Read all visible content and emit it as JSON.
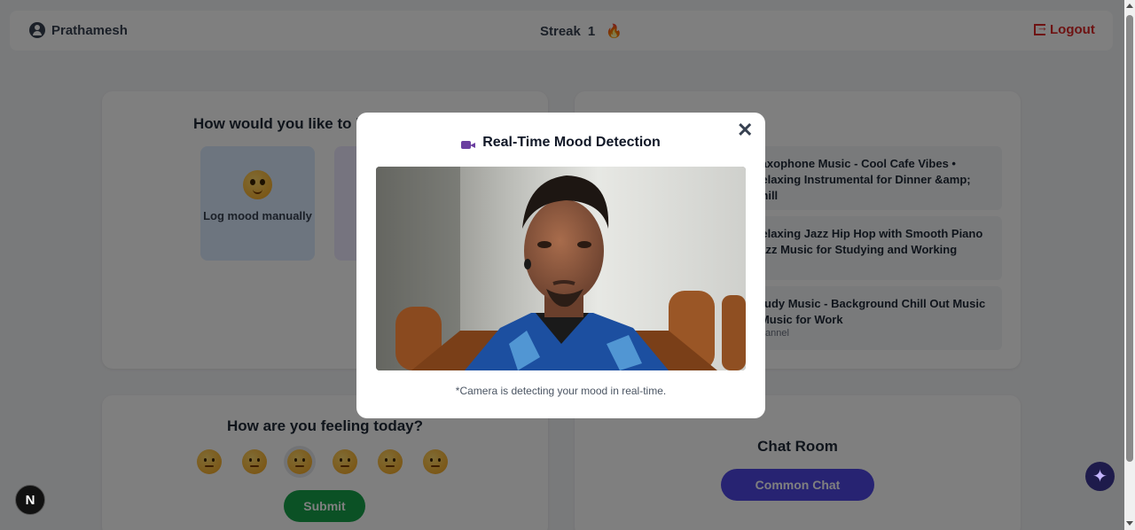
{
  "header": {
    "user_name": "Prathamesh",
    "streak_label": "Streak",
    "streak_count": "1",
    "streak_icon": "🔥",
    "logout_label": "Logout"
  },
  "log_card": {
    "title": "How would you like to log your mood?",
    "manual_label": "Log mood manually"
  },
  "music": {
    "items": [
      {
        "title": "Saxophone Music - Cool Cafe Vibes • Relaxing Instrumental for Dinner &amp; Chill",
        "subtitle": ""
      },
      {
        "title": "Relaxing Jazz Hip Hop with Smooth Piano Jazz Music for Studying and Working",
        "subtitle": ""
      },
      {
        "title": "Study Music - Background Chill Out Music - Music for Work",
        "subtitle": "Channel"
      }
    ]
  },
  "feel_card": {
    "title": "How are you feeling today?",
    "submit_label": "Submit"
  },
  "chat_card": {
    "title": "Chat Room",
    "button_label": "Common Chat"
  },
  "modal": {
    "title": "Real-Time Mood Detection",
    "close_symbol": "✕",
    "caption": "*Camera is detecting your mood in real-time."
  },
  "floating": {
    "next_badge": "N",
    "ai_icon": "✦"
  },
  "colors": {
    "logout": "#dc2626",
    "submit": "#16a34a",
    "chat_button": "#4f46e5"
  }
}
